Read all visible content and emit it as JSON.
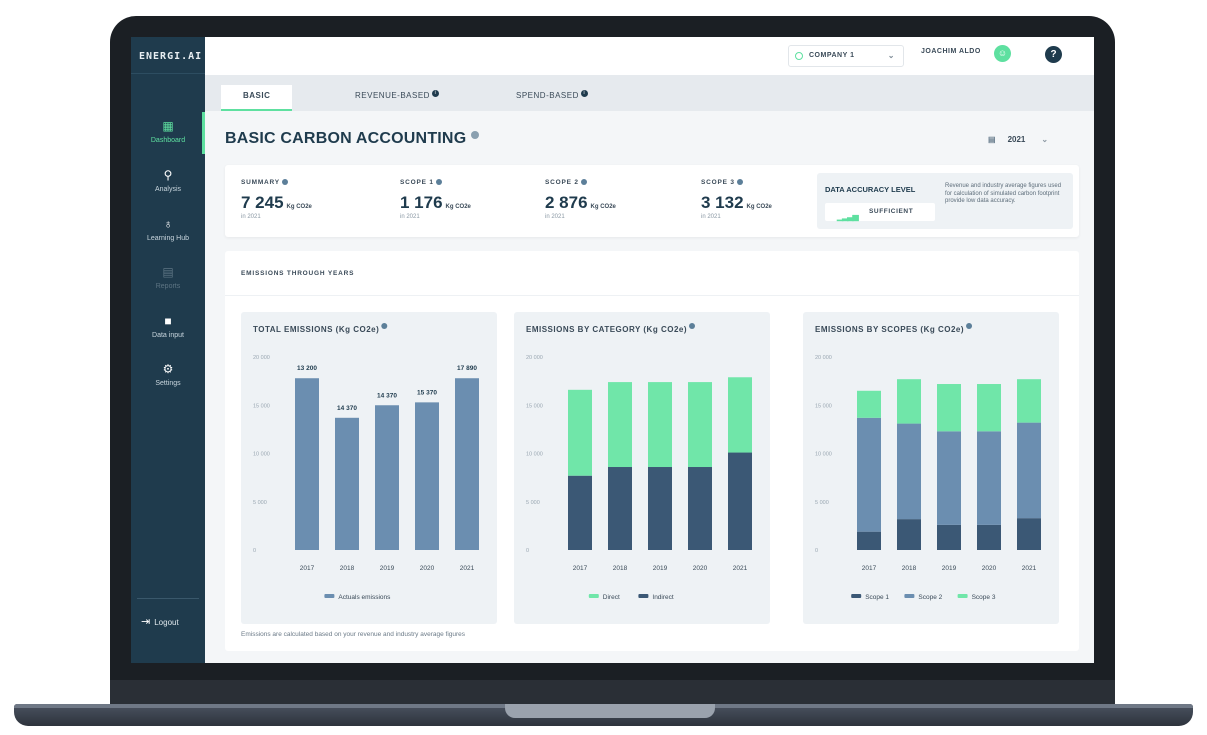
{
  "app": {
    "logo": "ENERGI.AI"
  },
  "sidebar": {
    "items": [
      {
        "label": "Dashboard",
        "icon": "dashboard-icon",
        "state": "active"
      },
      {
        "label": "Analysis",
        "icon": "analysis-icon",
        "state": "normal"
      },
      {
        "label": "Learning Hub",
        "icon": "lightbulb-icon",
        "state": "normal"
      },
      {
        "label": "Reports",
        "icon": "reports-icon",
        "state": "disabled"
      },
      {
        "label": "Data input",
        "icon": "folder-icon",
        "state": "normal"
      },
      {
        "label": "Settings",
        "icon": "settings-icon",
        "state": "normal"
      }
    ],
    "logout": "Logout"
  },
  "header": {
    "company": "COMPANY 1",
    "user": "JOACHIM ALDO",
    "help": "?"
  },
  "tabs": [
    {
      "label": "BASIC",
      "active": true
    },
    {
      "label": "REVENUE-BASED",
      "active": false
    },
    {
      "label": "SPEND-BASED",
      "active": false
    }
  ],
  "page": {
    "title": "BASIC CARBON ACCOUNTING",
    "year": "2021"
  },
  "summary": {
    "metrics": [
      {
        "label": "SUMMARY",
        "value": "7 245",
        "unit": "Kg CO2e",
        "sub": "in 2021"
      },
      {
        "label": "SCOPE 1",
        "value": "1 176",
        "unit": "Kg CO2e",
        "sub": "in 2021"
      },
      {
        "label": "SCOPE 2",
        "value": "2 876",
        "unit": "Kg CO2e",
        "sub": "in 2021"
      },
      {
        "label": "SCOPE 3",
        "value": "3 132",
        "unit": "Kg CO2e",
        "sub": "in 2021"
      }
    ],
    "accuracy": {
      "title": "DATA ACCURACY LEVEL",
      "level": "SUFFICIENT",
      "description": "Revenue and industry average figures used for calculation of simulated carbon footprint provide low data accuracy."
    }
  },
  "emissions": {
    "title": "EMISSIONS THROUGH YEARS",
    "footnote": "Emissions are calculated based on your revenue and industry average figures"
  },
  "colors": {
    "navy": "#1f3b4d",
    "accent_green": "#5ee0a0",
    "bar_blue": "#6b8eb0",
    "bar_dark": "#3b5875",
    "bar_light": "#70e6a9"
  },
  "chart_data": [
    {
      "type": "bar",
      "title": "TOTAL EMISSIONS (Kg CO2e)",
      "categories": [
        "2017",
        "2018",
        "2019",
        "2020",
        "2021"
      ],
      "ylim": [
        0,
        20000
      ],
      "yticks": [
        "0",
        "5 000",
        "10 000",
        "15 000",
        "20 000"
      ],
      "series": [
        {
          "name": "Actuals emissions",
          "values": [
            17800,
            13700,
            15000,
            15300,
            17800
          ],
          "color": "#6b8eb0"
        }
      ],
      "data_labels": [
        "13 200",
        "14 370",
        "14 370",
        "15 370",
        "17 890"
      ]
    },
    {
      "type": "bar",
      "stacked": true,
      "title": "EMISSIONS BY CATEGORY (Kg CO2e)",
      "categories": [
        "2017",
        "2018",
        "2019",
        "2020",
        "2021"
      ],
      "ylim": [
        0,
        20000
      ],
      "yticks": [
        "0",
        "5 000",
        "10 000",
        "15 000",
        "20 000"
      ],
      "series": [
        {
          "name": "Indirect",
          "values": [
            7700,
            8600,
            8600,
            8600,
            10100
          ],
          "color": "#3b5875"
        },
        {
          "name": "Direct",
          "values": [
            8900,
            8800,
            8800,
            8800,
            7800
          ],
          "color": "#70e6a9"
        }
      ],
      "legend_order": [
        "Direct",
        "Indirect"
      ]
    },
    {
      "type": "bar",
      "stacked": true,
      "title": "EMISSIONS BY SCOPES (Kg CO2e)",
      "categories": [
        "2017",
        "2018",
        "2019",
        "2020",
        "2021"
      ],
      "ylim": [
        0,
        20000
      ],
      "yticks": [
        "0",
        "5 000",
        "10 000",
        "15 000",
        "20 000"
      ],
      "series": [
        {
          "name": "Scope 1",
          "values": [
            1900,
            3200,
            2600,
            2600,
            3300
          ],
          "color": "#3b5875"
        },
        {
          "name": "Scope 2",
          "values": [
            11800,
            9900,
            9700,
            9700,
            9900
          ],
          "color": "#6b8eb0"
        },
        {
          "name": "Scope 3",
          "values": [
            2800,
            4600,
            4900,
            4900,
            4500
          ],
          "color": "#70e6a9"
        }
      ]
    }
  ]
}
